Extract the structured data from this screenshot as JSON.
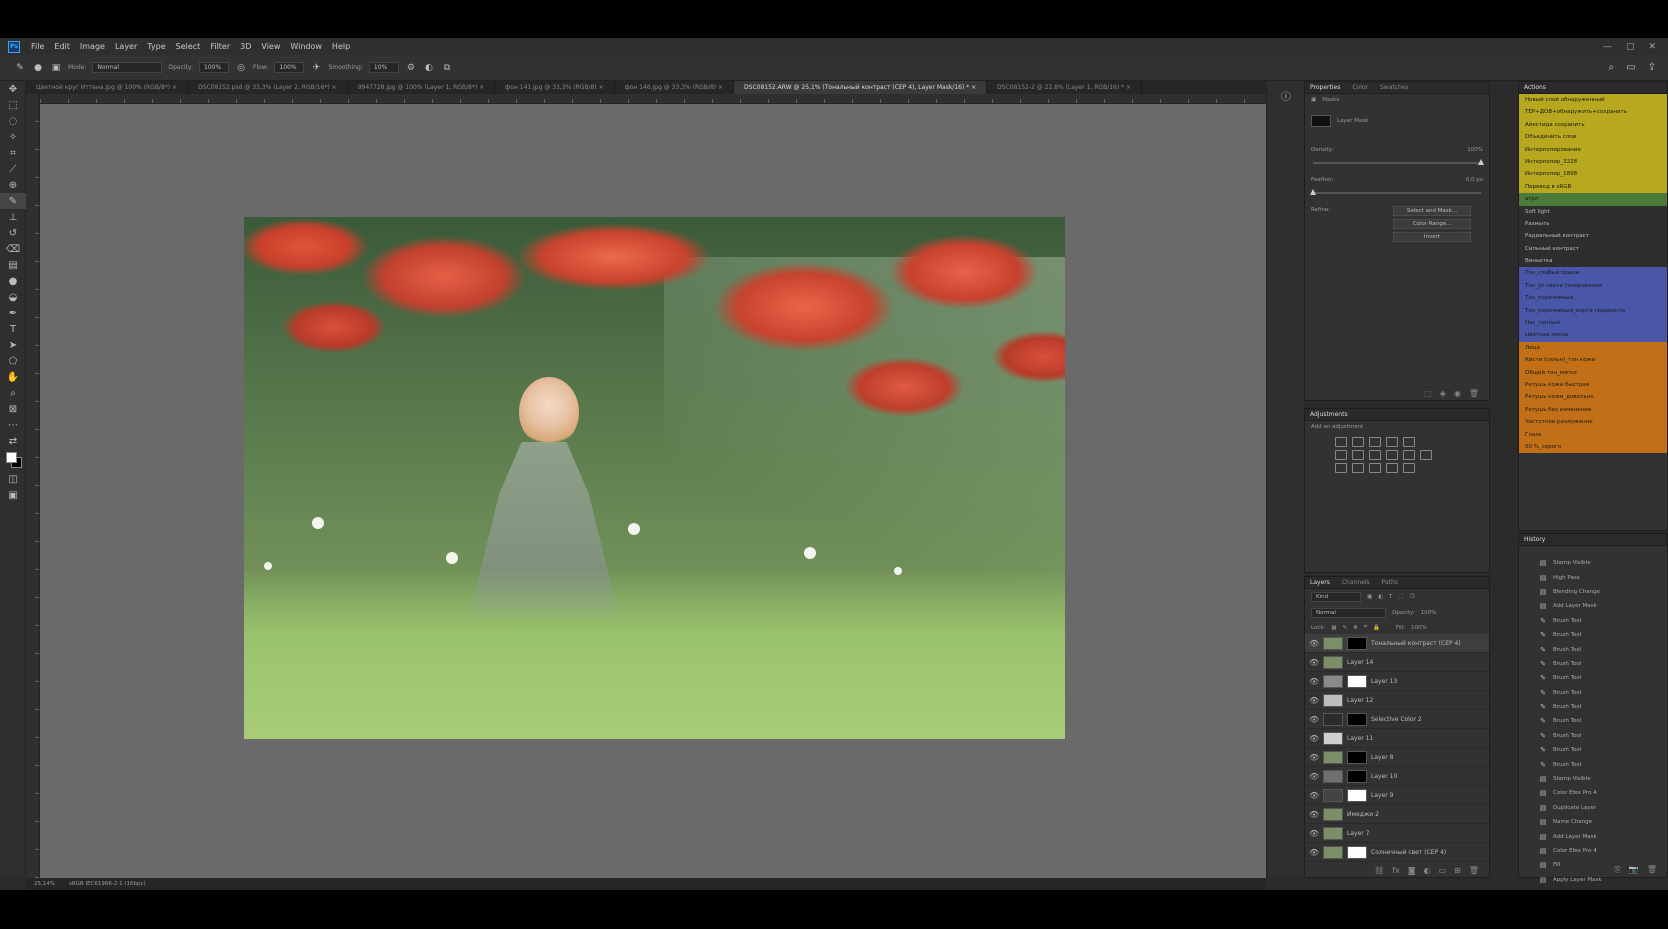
{
  "app": {
    "name": "Ps",
    "menu": [
      "File",
      "Edit",
      "Image",
      "Layer",
      "Type",
      "Select",
      "Filter",
      "3D",
      "View",
      "Window",
      "Help"
    ],
    "window_controls": [
      "—",
      "▢",
      "✕"
    ]
  },
  "options_bar": {
    "mode_label": "Mode:",
    "mode_value": "Normal",
    "opacity_label": "Opacity:",
    "opacity_value": "100%",
    "flow_label": "Flow:",
    "flow_value": "100%",
    "smoothing_label": "Smoothing:",
    "smoothing_value": "10%"
  },
  "tabs": [
    {
      "label": "Цветной круг Иттена.jpg @ 100% (RGB/8*) ×",
      "active": false
    },
    {
      "label": "DSC08152.psd @ 33,3% (Layer 2, RGB/16*) ×",
      "active": false
    },
    {
      "label": "9947728.jpg @ 100% (Layer 1, RGB/8*) ×",
      "active": false
    },
    {
      "label": "фон 141.jpg @ 33,3% (RGB/8) ×",
      "active": false
    },
    {
      "label": "фон 146.jpg @ 33,3% (RGB/8) ×",
      "active": false
    },
    {
      "label": "DSC08152.ARW @ 25,1% (Тональный контраст (СЕР 4), Layer Mask/16) * ×",
      "active": true
    },
    {
      "label": "DSC08152-2 @ 22,8% (Layer 1, RGB/16) * ×",
      "active": false
    }
  ],
  "status": {
    "zoom": "25,14%",
    "doc": "sRGB IEC61966-2.1 (16bpc)"
  },
  "properties": {
    "tabs": [
      "Properties",
      "Color",
      "Swatches"
    ],
    "section": "Masks",
    "mask_label": "Layer Mask",
    "density_label": "Density:",
    "density_value": "100%",
    "feather_label": "Feather:",
    "feather_value": "0,0 px",
    "density_level": 1.0,
    "feather_level": 0.0,
    "refine_label": "Refine:",
    "buttons": [
      "Select and Mask...",
      "Color Range...",
      "Invert"
    ]
  },
  "adjustments": {
    "title": "Adjustments",
    "subtitle": "Add an adjustment"
  },
  "layers": {
    "tabs": [
      "Layers",
      "Channels",
      "Paths"
    ],
    "filter_kind": "Kind",
    "blend_mode": "Normal",
    "opacity_label": "Opacity:",
    "opacity_value": "100%",
    "lock_label": "Lock:",
    "fill_label": "Fill:",
    "fill_value": "100%",
    "items": [
      {
        "name": "Тональный контраст (СЕР 4)",
        "selected": true,
        "mask": "black",
        "thumb": "#7a8f66"
      },
      {
        "name": "Layer 14",
        "selected": false,
        "mask": "",
        "thumb": "#7a8f66"
      },
      {
        "name": "Layer 13",
        "selected": false,
        "mask": "white",
        "thumb": "#8a8a8a"
      },
      {
        "name": "Layer 12",
        "selected": false,
        "mask": "",
        "thumb": "#bdbdbd"
      },
      {
        "name": "Selective Color 2",
        "selected": false,
        "mask": "black",
        "thumb": "#2b2b2b"
      },
      {
        "name": "Layer 11",
        "selected": false,
        "mask": "",
        "thumb": "#cfcfcf"
      },
      {
        "name": "Layer 8",
        "selected": false,
        "mask": "black",
        "thumb": "#7a8f66"
      },
      {
        "name": "Layer 10",
        "selected": false,
        "mask": "black",
        "thumb": "#6f6f6f"
      },
      {
        "name": "Layer 9",
        "selected": false,
        "mask": "white",
        "thumb": "#444"
      },
      {
        "name": "Имеджи 2",
        "selected": false,
        "mask": "",
        "thumb": "#7a8f66"
      },
      {
        "name": "Layer 7",
        "selected": false,
        "mask": "",
        "thumb": "#7a8f66"
      },
      {
        "name": "Солнечный свет (СЕР 4)",
        "selected": false,
        "mask": "white",
        "thumb": "#7a8f66"
      }
    ]
  },
  "actions": {
    "title": "Actions",
    "items": [
      {
        "label": "Новый слой обнаруженный",
        "color": "#b8a820"
      },
      {
        "label": "ТЕР+ДОВ+обнаружить+сохранить",
        "color": "#b8a820"
      },
      {
        "label": "Айестида сохранить",
        "color": "#b8a820"
      },
      {
        "label": "Объединить слои",
        "color": "#b8a820"
      },
      {
        "label": "Интерполирование",
        "color": "#b8a820"
      },
      {
        "label": "Интерполир_3228",
        "color": "#b8a820"
      },
      {
        "label": "Интерполир_1898",
        "color": "#b8a820"
      },
      {
        "label": "Перевод в sRGB",
        "color": "#b8a820"
      },
      {
        "label": "агрл",
        "color": "#4c7a3a"
      },
      {
        "label": "Soft light",
        "color": "#2e2e2e"
      },
      {
        "label": "Размыть",
        "color": "#2e2e2e"
      },
      {
        "label": "Радиальный контраст",
        "color": "#2e2e2e"
      },
      {
        "label": "Сильный контраст",
        "color": "#2e2e2e"
      },
      {
        "label": "Виньетка",
        "color": "#2e2e2e"
      },
      {
        "label": "Тон_слабый оранж",
        "color": "#4a57a8"
      },
      {
        "label": "Тон_от света тонирования",
        "color": "#4a57a8"
      },
      {
        "label": "Тон_коричневый",
        "color": "#4a57a8"
      },
      {
        "label": "Тон_коричневый_карта градиента",
        "color": "#4a57a8"
      },
      {
        "label": "Нас_теплый",
        "color": "#4a57a8"
      },
      {
        "label": "Цветная линза",
        "color": "#4a57a8"
      },
      {
        "label": "Лица",
        "color": "#c27018"
      },
      {
        "label": "Кисти (сильн)_тон кожи",
        "color": "#c27018"
      },
      {
        "label": "Общий тон_мягко",
        "color": "#c27018"
      },
      {
        "label": "Ретушь кожи быстрая",
        "color": "#c27018"
      },
      {
        "label": "Ретушь кожи_довольно",
        "color": "#c27018"
      },
      {
        "label": "Ретушь без изменения",
        "color": "#c27018"
      },
      {
        "label": "Частотное разложение",
        "color": "#c27018"
      },
      {
        "label": "Глаза",
        "color": "#c27018"
      },
      {
        "label": "50 %_серого",
        "color": "#c27018"
      }
    ]
  },
  "history": {
    "title": "History",
    "items": [
      {
        "label": "Stamp Visible",
        "icon": "doc"
      },
      {
        "label": "High Pass",
        "icon": "doc"
      },
      {
        "label": "Blending Change",
        "icon": "doc"
      },
      {
        "label": "Add Layer Mask",
        "icon": "doc"
      },
      {
        "label": "Brush Tool",
        "icon": "brush"
      },
      {
        "label": "Brush Tool",
        "icon": "brush"
      },
      {
        "label": "Brush Tool",
        "icon": "brush"
      },
      {
        "label": "Brush Tool",
        "icon": "brush"
      },
      {
        "label": "Brush Tool",
        "icon": "brush"
      },
      {
        "label": "Brush Tool",
        "icon": "brush"
      },
      {
        "label": "Brush Tool",
        "icon": "brush"
      },
      {
        "label": "Brush Tool",
        "icon": "brush"
      },
      {
        "label": "Brush Tool",
        "icon": "brush"
      },
      {
        "label": "Brush Tool",
        "icon": "brush"
      },
      {
        "label": "Brush Tool",
        "icon": "brush"
      },
      {
        "label": "Stamp Visible",
        "icon": "doc"
      },
      {
        "label": "Color Efex Pro 4",
        "icon": "doc"
      },
      {
        "label": "Duplicate Layer",
        "icon": "doc"
      },
      {
        "label": "Name Change",
        "icon": "doc"
      },
      {
        "label": "Add Layer Mask",
        "icon": "doc"
      },
      {
        "label": "Color Efex Pro 4",
        "icon": "doc"
      },
      {
        "label": "Fill",
        "icon": "doc"
      },
      {
        "label": "Apply Layer Mask",
        "icon": "doc"
      },
      {
        "label": "Name Change",
        "icon": "doc"
      },
      {
        "label": "Add Layer Mask",
        "icon": "doc",
        "selected": true
      }
    ]
  },
  "colors": {
    "ps_blue": "#31a8ff",
    "canvas_bg": "#6a6a6a",
    "panel_bg": "#323232"
  }
}
